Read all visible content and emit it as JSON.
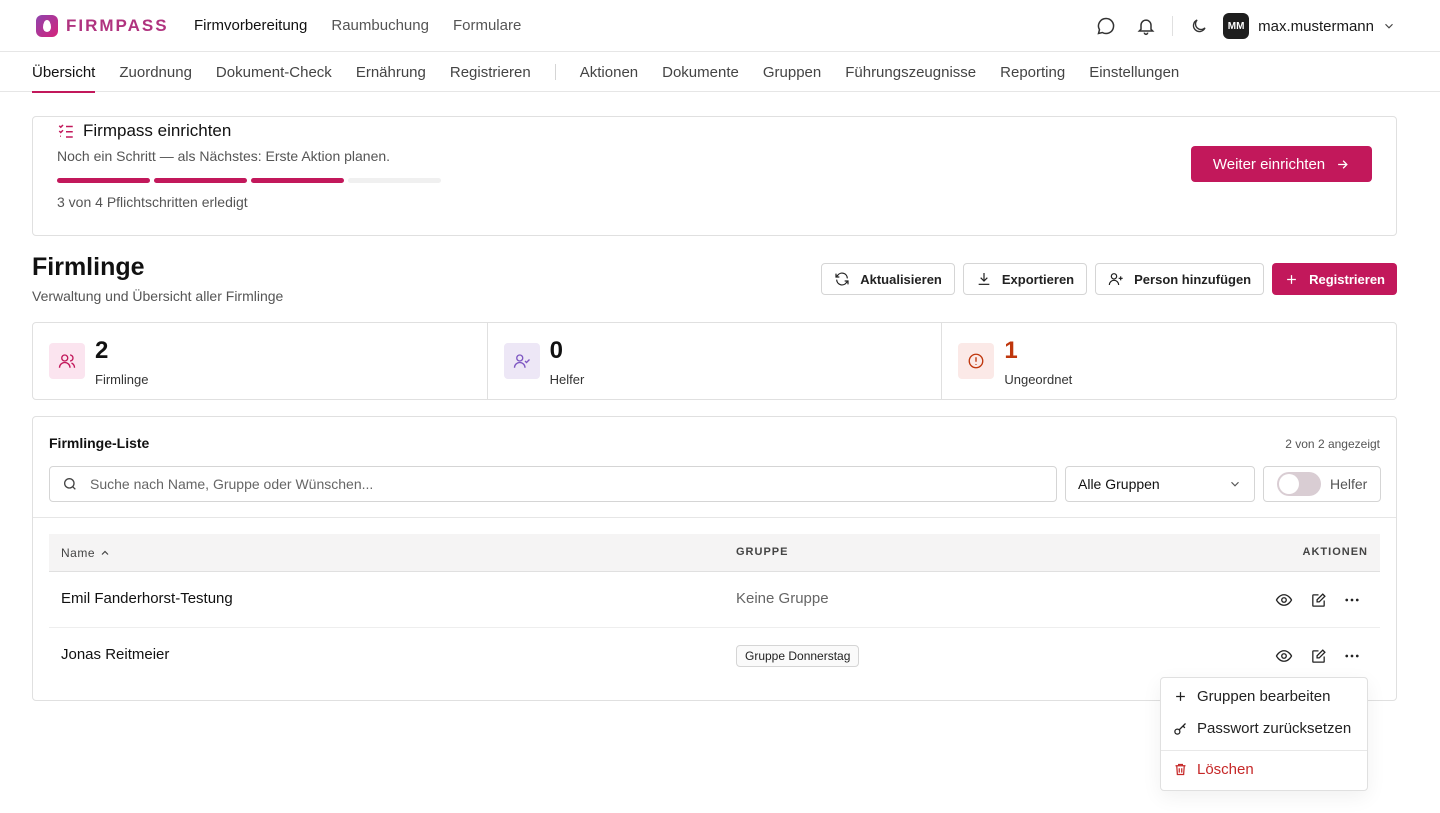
{
  "app": {
    "brand": "FIRMPASS"
  },
  "topnav": [
    "Firmvorbereitung",
    "Raumbuchung",
    "Formulare"
  ],
  "user": {
    "initials": "MM",
    "name": "max.mustermann"
  },
  "subnav": {
    "primary": [
      "Übersicht",
      "Zuordnung",
      "Dokument-Check",
      "Ernährung",
      "Registrieren"
    ],
    "secondary": [
      "Aktionen",
      "Dokumente",
      "Gruppen",
      "Führungszeugnisse",
      "Reporting",
      "Einstellungen"
    ]
  },
  "setup": {
    "title": "Firmpass einrichten",
    "subtitle": "Noch ein Schritt — als Nächstes: Erste Aktion planen.",
    "progress_done": 3,
    "progress_total": 4,
    "count_text": "3 von 4 Pflichtschritten erledigt",
    "button": "Weiter einrichten"
  },
  "page": {
    "title": "Firmlinge",
    "subtitle": "Verwaltung und Übersicht aller Firmlinge",
    "actions": {
      "refresh": "Aktualisieren",
      "export": "Exportieren",
      "add_person": "Person hinzufügen",
      "register": "Registrieren"
    }
  },
  "stats": [
    {
      "value": "2",
      "label": "Firmlinge",
      "color": "#c2185b",
      "bg": "#fbe4ef",
      "icon": "users-icon"
    },
    {
      "value": "0",
      "label": "Helfer",
      "color": "#7e57c2",
      "bg": "#ede7f6",
      "icon": "user-check-icon"
    },
    {
      "value": "1",
      "label": "Ungeordnet",
      "color": "#bf360c",
      "bg": "#fbe9e7",
      "icon": "alert-icon"
    }
  ],
  "list": {
    "title": "Firmlinge-Liste",
    "count": "2 von 2 angezeigt",
    "search_placeholder": "Suche nach Name, Gruppe oder Wünschen...",
    "group_filter": "Alle Gruppen",
    "helper_toggle": "Helfer",
    "columns": {
      "name": "Name",
      "group": "GRUPPE",
      "actions": "AKTIONEN"
    },
    "rows": [
      {
        "name": "Emil Fanderhorst-Testung",
        "group": "Keine Gruppe",
        "has_group": false
      },
      {
        "name": "Jonas Reitmeier",
        "group": "Gruppe Donnerstag",
        "has_group": true
      }
    ]
  },
  "menu": {
    "edit_groups": "Gruppen bearbeiten",
    "reset_password": "Passwort zurücksetzen",
    "delete": "Löschen"
  },
  "colors": {
    "accent": "#c2185b",
    "danger": "#c62828"
  }
}
